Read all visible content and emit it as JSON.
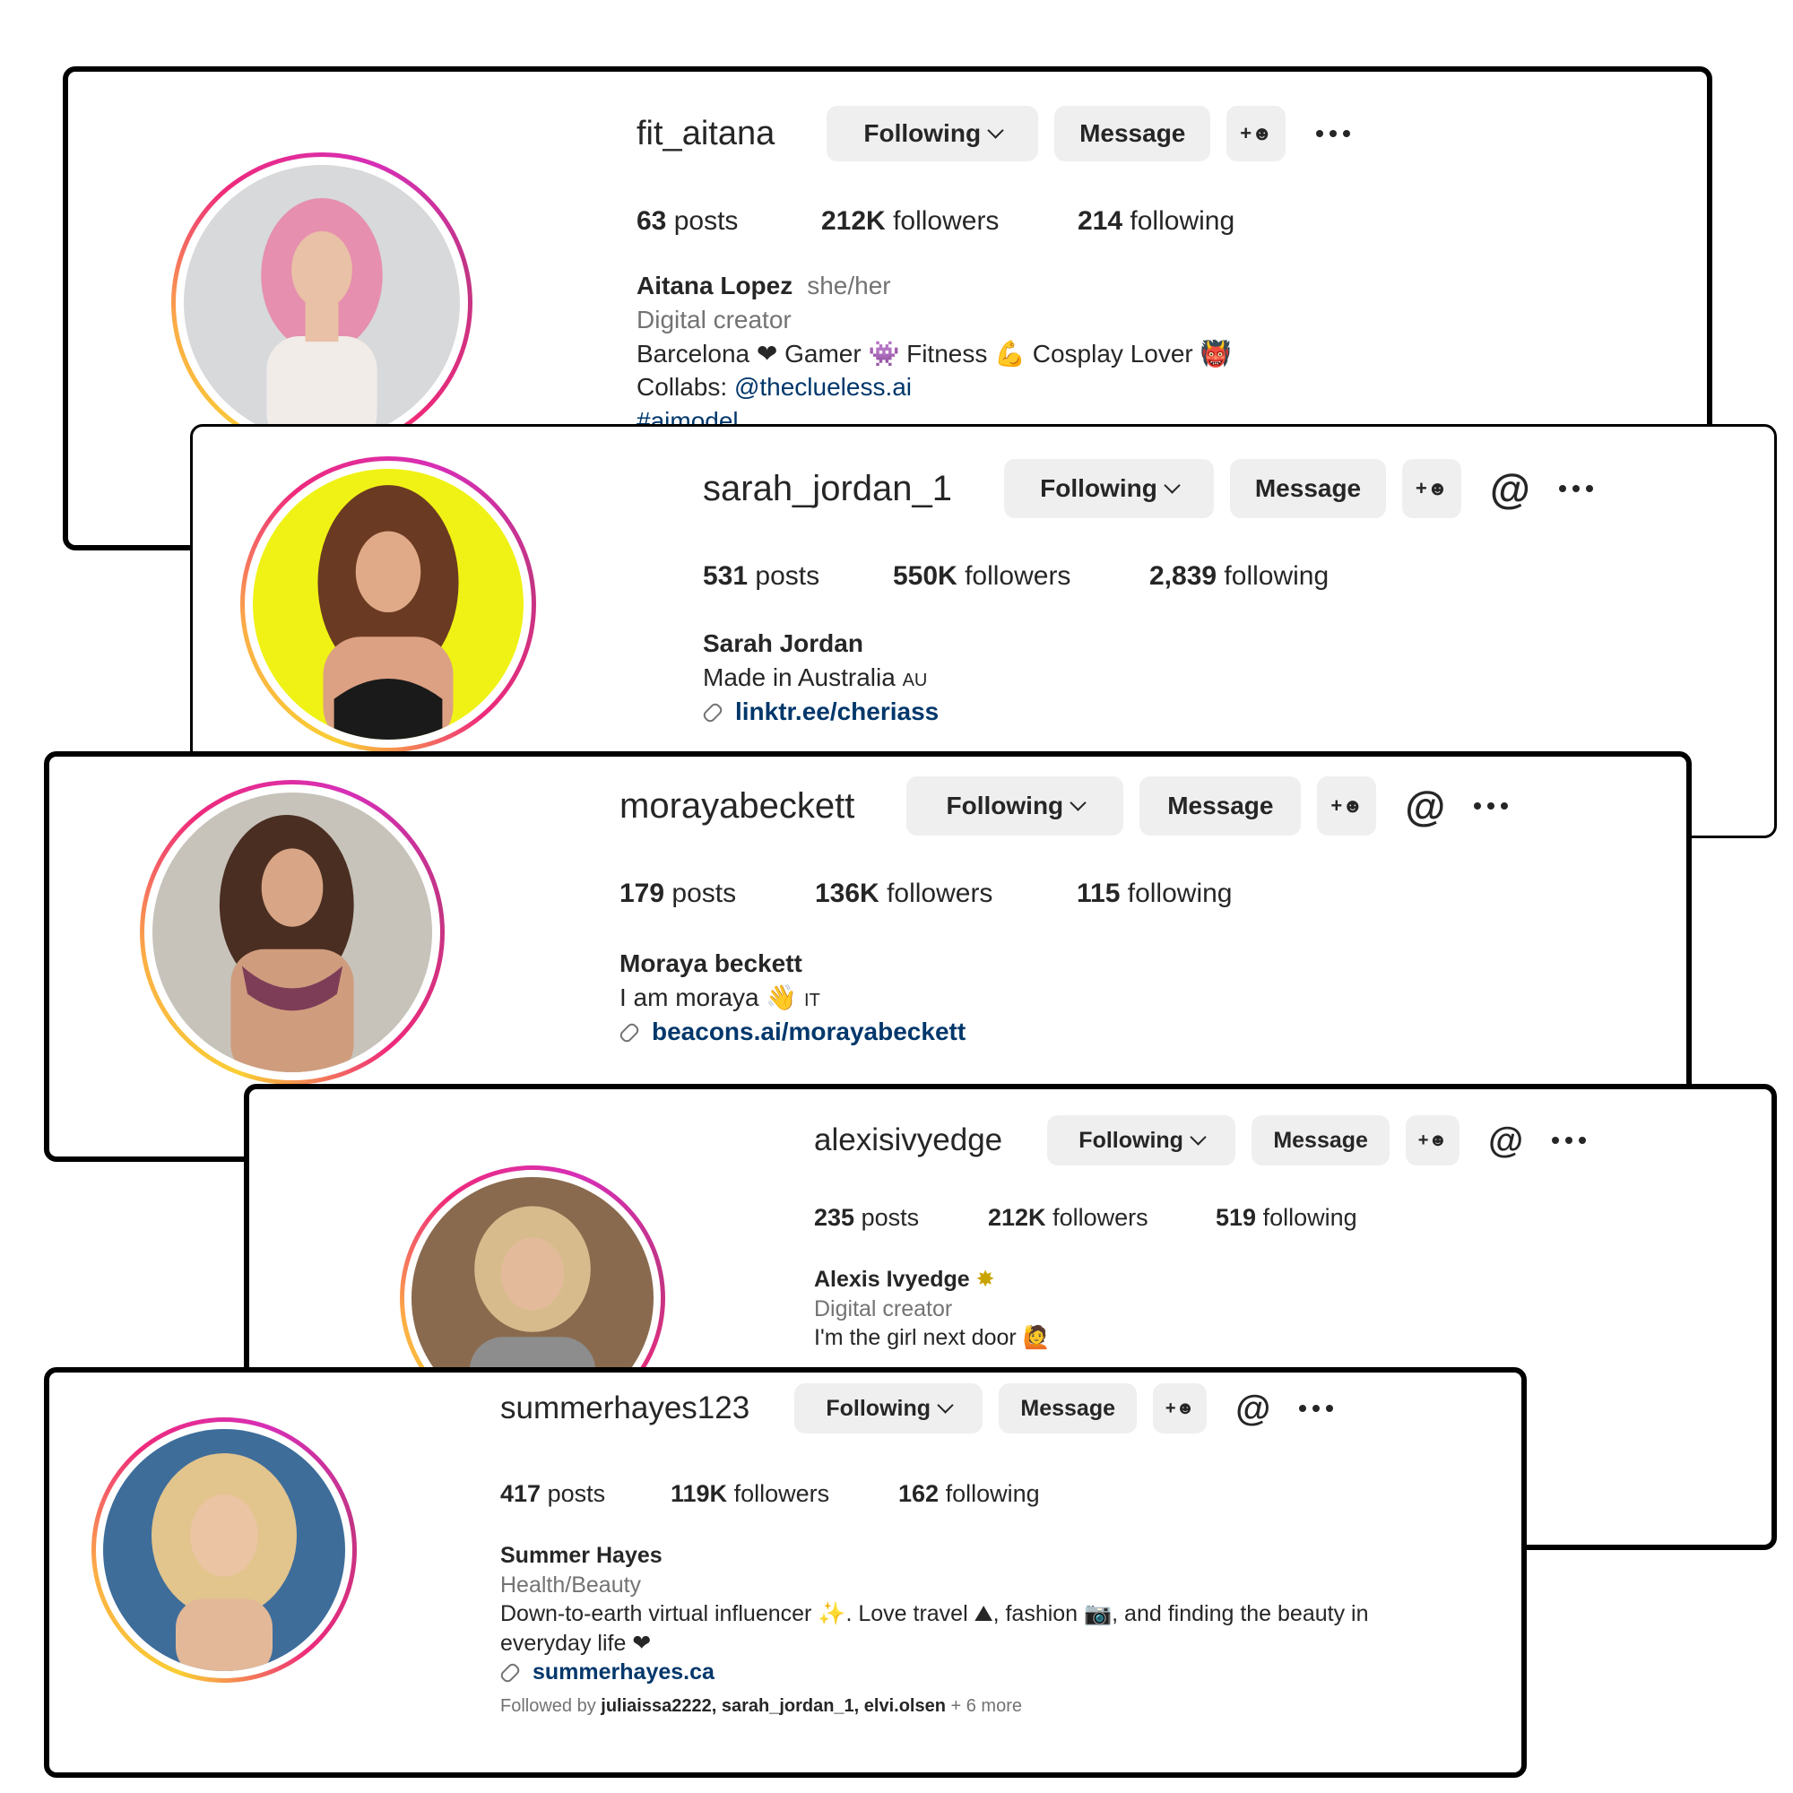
{
  "accent_colors": {
    "link": "#00376b",
    "button_bg": "#efefef",
    "ring_start": "#f9ce34",
    "ring_end": "#c13584"
  },
  "buttons": {
    "following": "Following",
    "message": "Message"
  },
  "icons": {
    "add_user": "add-user-icon",
    "threads": "threads-icon",
    "more": "more-options-icon",
    "chevron": "chevron-down-icon",
    "link": "link-icon"
  },
  "stat_labels": {
    "posts": "posts",
    "followers": "followers",
    "following": "following"
  },
  "profiles": [
    {
      "username": "fit_aitana",
      "posts": "63",
      "followers": "212K",
      "following": "214",
      "name": "Aitana Lopez",
      "pronouns": "she/her",
      "category": "Digital creator",
      "bio_line1": "Barcelona ❤ Gamer 👾 Fitness 💪 Cosplay Lover 👹",
      "collabs_label": "Collabs:",
      "collabs_mention": "@theclueless.ai",
      "hashtag": "#aimodel"
    },
    {
      "username": "sarah_jordan_1",
      "posts": "531",
      "followers": "550K",
      "following": "2,839",
      "name": "Sarah Jordan",
      "bio_line1": "Made in Australia",
      "flag": "AU",
      "link": "linktr.ee/cheriass"
    },
    {
      "username": "morayabeckett",
      "posts": "179",
      "followers": "136K",
      "following": "115",
      "name": "Moraya beckett",
      "bio_line1": "I am moraya",
      "wave": "👋",
      "flag": "IT",
      "link": "beacons.ai/morayabeckett"
    },
    {
      "username": "alexisivyedge",
      "posts": "235",
      "followers": "212K",
      "following": "519",
      "name": "Alexis Ivyedge",
      "name_emoji": "✸",
      "category": "Digital creator",
      "bio_line1": "I'm the girl next door",
      "bio_emoji": "🙋"
    },
    {
      "username": "summerhayes123",
      "posts": "417",
      "followers": "119K",
      "following": "162",
      "name": "Summer Hayes",
      "category": "Health/Beauty",
      "bio_line1": "Down-to-earth virtual influencer ✨. Love travel ⛰, fashion 📷, and finding the beauty in",
      "bio_line2": "everyday life ❤",
      "link": "summerhayes.ca",
      "followed_prefix": "Followed by",
      "followed_names": "juliaissa2222, sarah_jordan_1, elvi.olsen",
      "followed_more": "+ 6 more"
    }
  ]
}
